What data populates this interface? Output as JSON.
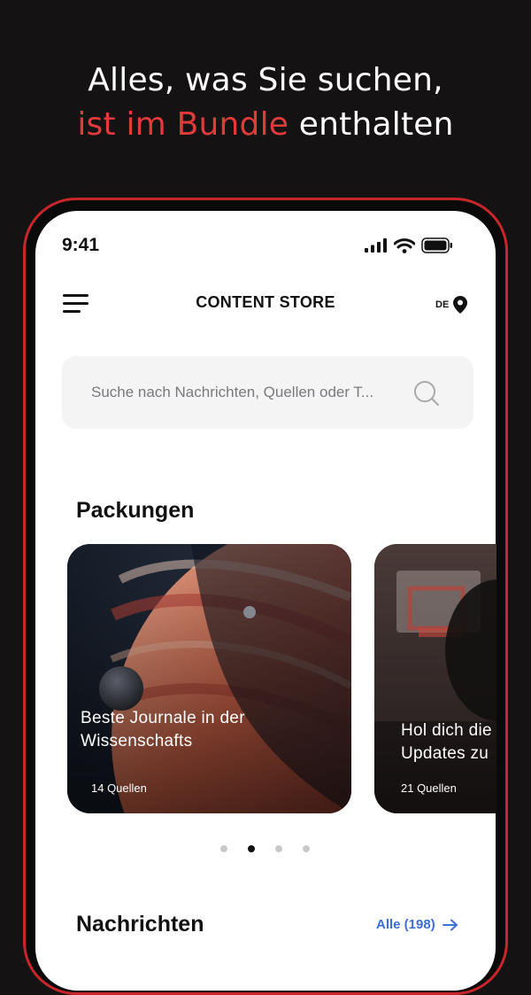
{
  "headline": {
    "line1": "Alles, was Sie suchen,",
    "accent": "ist im Bundle",
    "rest": "enthalten"
  },
  "status": {
    "time": "9:41"
  },
  "header": {
    "title": "CONTENT STORE",
    "region": "DE"
  },
  "search": {
    "placeholder": "Suche nach Nachrichten, Quellen oder T..."
  },
  "packages": {
    "title": "Packungen",
    "cards": [
      {
        "title_line1": "Beste Journale in der",
        "title_line2": "Wissenschafts",
        "count": "14 Quellen"
      },
      {
        "title_line1": "Hol dich die",
        "title_line2": "Updates zu",
        "count": "21 Quellen"
      }
    ],
    "active_page": 2,
    "page_count": 4
  },
  "news": {
    "title": "Nachrichten",
    "all_label": "Alle (198)"
  },
  "colors": {
    "accent": "#e23b3b",
    "frame": "#c8262a",
    "link": "#3b6ed8",
    "background": "#141213"
  },
  "icons": [
    "menu-icon",
    "location-pin-icon",
    "search-icon",
    "signal-icon",
    "wifi-icon",
    "battery-icon",
    "arrow-right-icon"
  ]
}
